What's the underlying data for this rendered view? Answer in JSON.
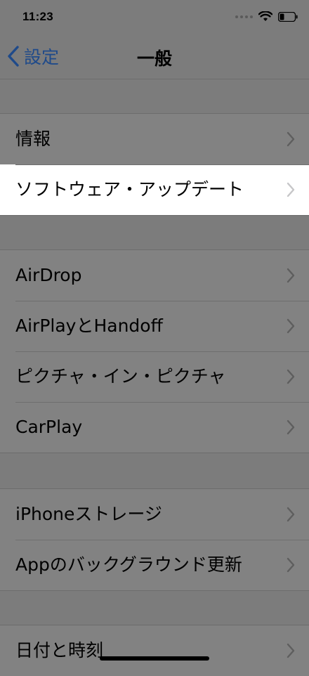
{
  "status_bar": {
    "time": "11:23",
    "battery_level": 0.3
  },
  "nav": {
    "back_label": "設定",
    "title": "一般"
  },
  "groups": [
    {
      "items": [
        {
          "label": "情報"
        },
        {
          "label": "ソフトウェア・アップデート",
          "highlighted": true
        }
      ]
    },
    {
      "items": [
        {
          "label": "AirDrop"
        },
        {
          "label": "AirPlayとHandoff"
        },
        {
          "label": "ピクチャ・イン・ピクチャ"
        },
        {
          "label": "CarPlay"
        }
      ]
    },
    {
      "items": [
        {
          "label": "iPhoneストレージ"
        },
        {
          "label": "Appのバックグラウンド更新"
        }
      ]
    },
    {
      "items": [
        {
          "label": "日付と時刻"
        }
      ]
    }
  ],
  "colors": {
    "overlay_background": "#7c7c7c",
    "highlight": "#ffffff",
    "accent": "#1f4a8a"
  }
}
